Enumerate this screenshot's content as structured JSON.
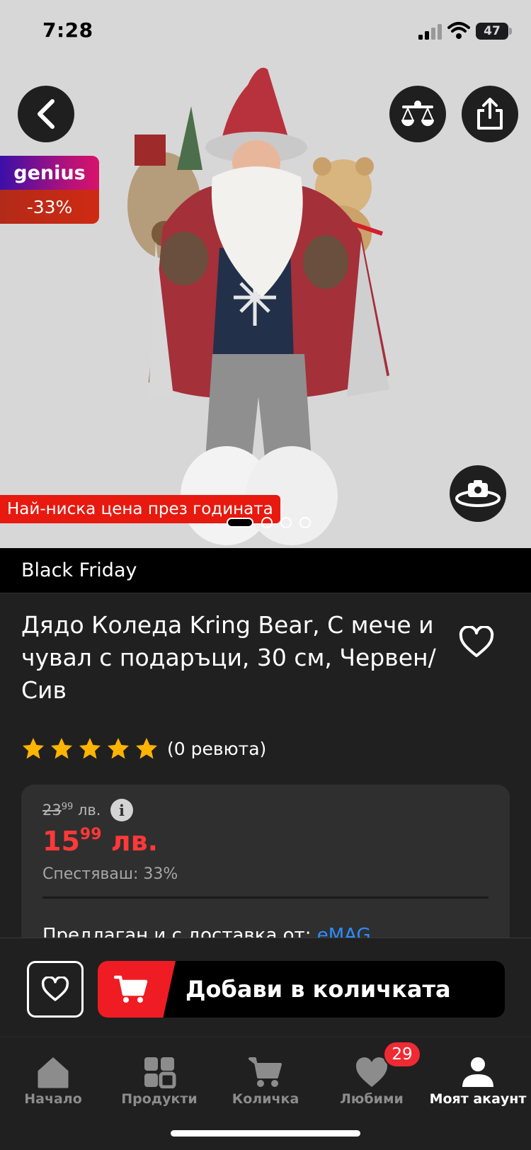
{
  "status_bar": {
    "time": "7:28",
    "battery": "47"
  },
  "product": {
    "genius_label": "genius",
    "discount_badge": "-33%",
    "lowest_price_badge": "Най-ниска цена през годината",
    "image_count": 4,
    "active_image_index": 0,
    "campaign": "Black Friday",
    "title": "Дядо Коледа Kring Bear, С мече и чувал с подаръци, 30 см, Червен/Сив",
    "rating": 5,
    "reviews_text": "(0 ревюта)",
    "old_price_int": "23",
    "old_price_dec": "99",
    "old_price_currency": "лв.",
    "info_symbol": "i",
    "new_price_int": "15",
    "new_price_dec": "99",
    "new_price_currency": "лв.",
    "savings_text": "Спестяваш: 33%",
    "seller_prefix": "Предлаган и с доставка от:",
    "seller_name": "eMAG"
  },
  "actions": {
    "add_to_cart": "Добави в количката"
  },
  "tabs": [
    {
      "label": "Начало",
      "icon": "home-icon"
    },
    {
      "label": "Продукти",
      "icon": "grid-icon"
    },
    {
      "label": "Количка",
      "icon": "cart-icon"
    },
    {
      "label": "Любими",
      "icon": "heart-icon",
      "badge": "29"
    },
    {
      "label": "Моят акаунт",
      "icon": "user-icon",
      "active": true
    }
  ],
  "colors": {
    "accent_red": "#ef1c23",
    "price_red": "#ff3838",
    "link_blue": "#2d8cff"
  }
}
